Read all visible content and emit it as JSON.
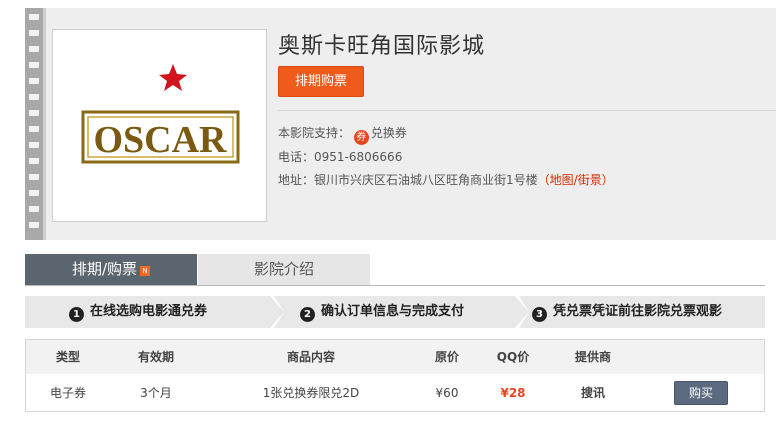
{
  "cinema": {
    "name": "奥斯卡旺角国际影城",
    "schedule_button": "排期购票",
    "support_label": "本影院支持：",
    "voucher_badge": "券",
    "voucher_text": "兑换券",
    "phone_label": "电话：",
    "phone": "0951-6806666",
    "address_label": "地址：",
    "address": "银川市兴庆区石油城八区旺角商业街1号楼",
    "paren_open": "（",
    "map_link": "地图/街景",
    "paren_close": "）",
    "logo_text": "OSCAR"
  },
  "tabs": {
    "active": "排期/购票",
    "hot_badge": "N",
    "inactive": "影院介绍"
  },
  "steps": [
    {
      "num": "1",
      "label": "在线选购电影通兑券"
    },
    {
      "num": "2",
      "label": "确认订单信息与完成支付"
    },
    {
      "num": "3",
      "label": "凭兑票凭证前往影院兑票观影"
    }
  ],
  "table": {
    "headers": [
      "类型",
      "有效期",
      "商品内容",
      "原价",
      "QQ价",
      "提供商"
    ],
    "row": {
      "type": "电子券",
      "validity": "3个月",
      "content": "1张兑换券限兑2D",
      "original_price": "¥60",
      "qq_price": "¥28",
      "provider": "搜讯",
      "buy_button": "购买"
    }
  },
  "colors": {
    "accent_orange": "#f05a1a",
    "qq_price": "#e8461c",
    "tab_active": "#5a6570",
    "buy_button": "#5c6a80"
  }
}
